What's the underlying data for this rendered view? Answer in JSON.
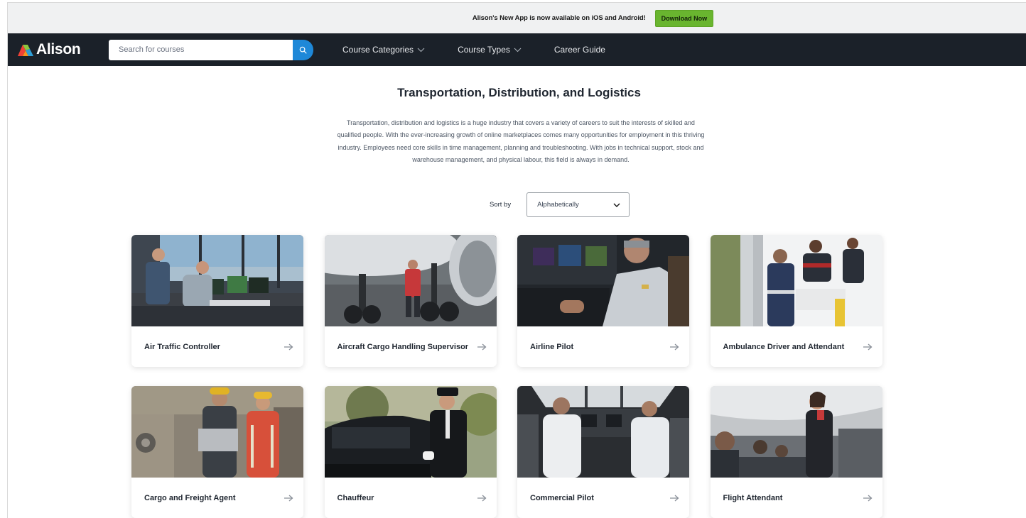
{
  "promo": {
    "text": "Alison's New App is now available on iOS and Android!",
    "button_label": "Download Now"
  },
  "nav": {
    "logo_text": "Alison",
    "search_placeholder": "Search for courses",
    "links": [
      {
        "label": "Course Categories",
        "has_dropdown": true
      },
      {
        "label": "Course Types",
        "has_dropdown": true
      },
      {
        "label": "Career Guide",
        "has_dropdown": false
      }
    ]
  },
  "page": {
    "title": "Transportation, Distribution, and Logistics",
    "intro": "Transportation, distribution and logistics is a huge industry that covers a variety of careers to suit the interests of skilled and qualified people. With the ever-increasing growth of online marketplaces comes many opportunities for employment in this thriving industry. Employees need core skills in time management, planning and troubleshooting. With jobs in technical support, stock and warehouse management, and physical labour, this field is always in demand.",
    "sort_label": "Sort by",
    "sort_value": "Alphabetically"
  },
  "careers": [
    {
      "title": "Air Traffic Controller",
      "icon": "control-tower-photo"
    },
    {
      "title": "Aircraft Cargo Handling Supervisor",
      "icon": "aircraft-ground-photo"
    },
    {
      "title": "Airline Pilot",
      "icon": "cockpit-pilot-photo"
    },
    {
      "title": "Ambulance Driver and Attendant",
      "icon": "ambulance-photo"
    },
    {
      "title": "Cargo and Freight Agent",
      "icon": "warehouse-workers-photo"
    },
    {
      "title": "Chauffeur",
      "icon": "chauffeur-car-photo"
    },
    {
      "title": "Commercial Pilot",
      "icon": "flight-deck-photo"
    },
    {
      "title": "Flight Attendant",
      "icon": "cabin-crew-photo"
    }
  ],
  "colors": {
    "nav_bg": "#1b2129",
    "promo_bg": "#f0f1f2",
    "download_button": "#69b52f",
    "search_button": "#1e88d8"
  }
}
